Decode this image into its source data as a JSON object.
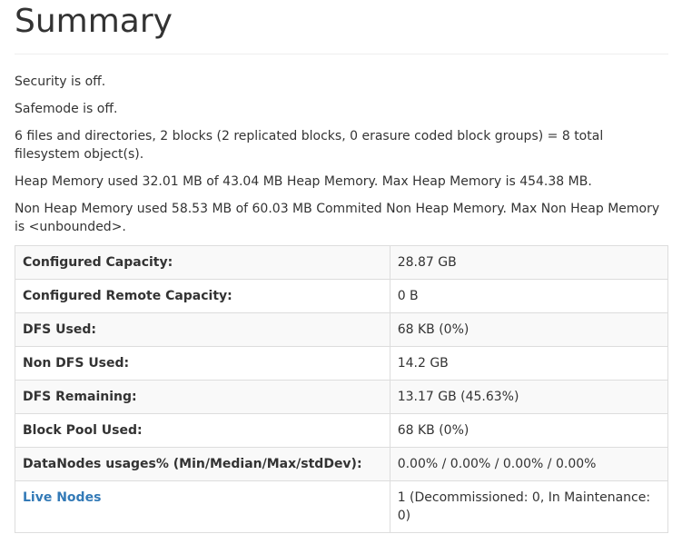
{
  "title": "Summary",
  "paragraphs": [
    "Security is off.",
    "Safemode is off.",
    "6 files and directories, 2 blocks (2 replicated blocks, 0 erasure coded block groups) = 8 total filesystem object(s).",
    "Heap Memory used 32.01 MB of 43.04 MB Heap Memory. Max Heap Memory is 454.38 MB.",
    "Non Heap Memory used 58.53 MB of 60.03 MB Commited Non Heap Memory. Max Non Heap Memory is <unbounded>."
  ],
  "rows": [
    {
      "label": "Configured Capacity:",
      "value": "28.87 GB"
    },
    {
      "label": "Configured Remote Capacity:",
      "value": "0 B"
    },
    {
      "label": "DFS Used:",
      "value": "68 KB (0%)"
    },
    {
      "label": "Non DFS Used:",
      "value": "14.2 GB"
    },
    {
      "label": "DFS Remaining:",
      "value": "13.17 GB (45.63%)"
    },
    {
      "label": "Block Pool Used:",
      "value": "68 KB (0%)"
    },
    {
      "label": "DataNodes usages% (Min/Median/Max/stdDev):",
      "value": "0.00% / 0.00% / 0.00% / 0.00%"
    },
    {
      "label": "Live Nodes",
      "value": "1 (Decommissioned: 0, In Maintenance: 0)"
    }
  ],
  "colors": {
    "link": "#337ab7",
    "text": "#333333",
    "border": "#dddddd",
    "stripe": "#f9f9f9"
  }
}
